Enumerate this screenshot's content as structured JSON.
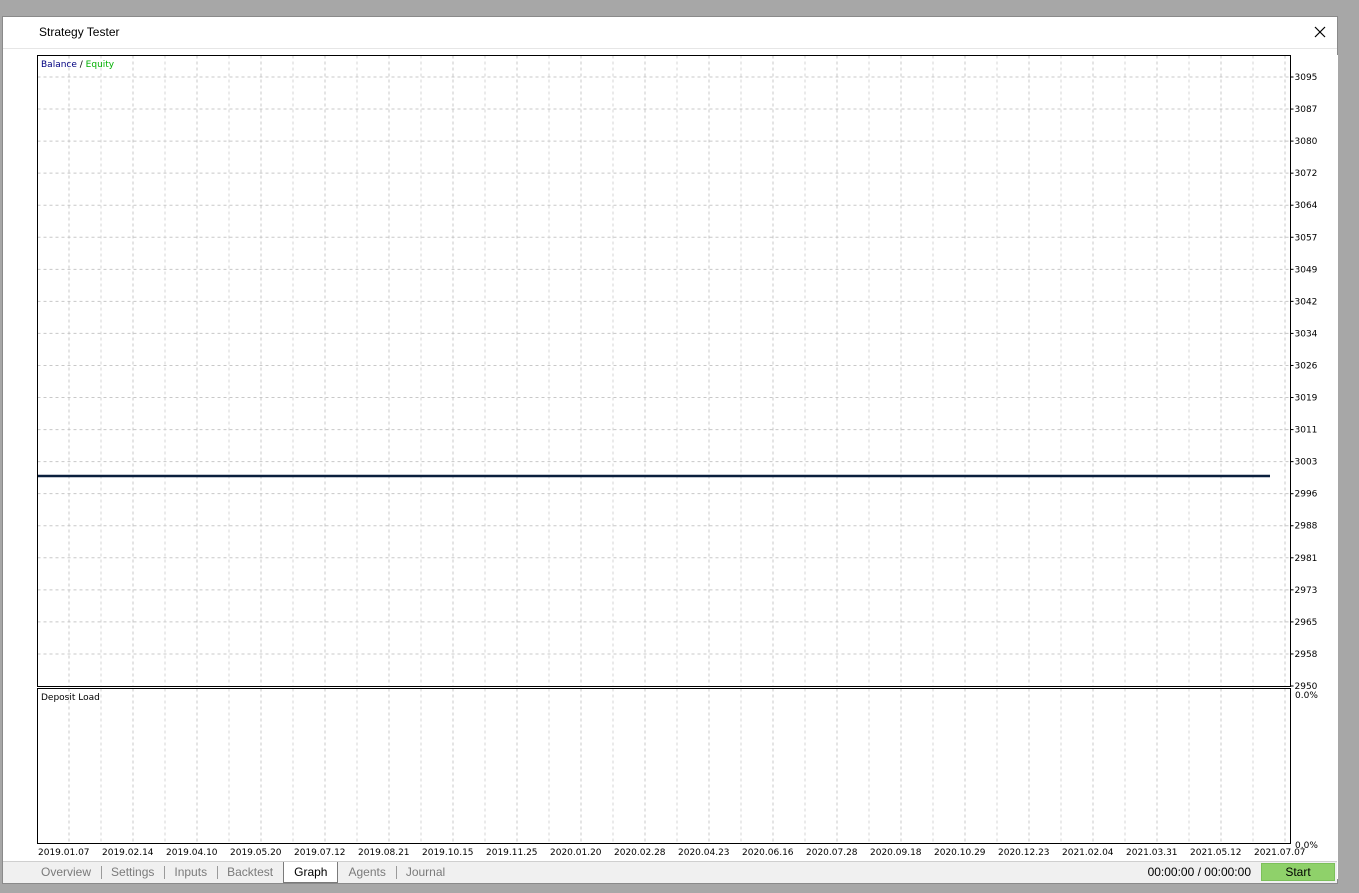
{
  "window": {
    "title": "Strategy Tester"
  },
  "legend": {
    "balance_label": "Balance",
    "separator": " / ",
    "equity_label": "Equity",
    "balance_color": "#000080",
    "equity_color": "#00b000"
  },
  "deposit_panel": {
    "label": "Deposit Load",
    "top_value": "0.0%",
    "bottom_value": "0.0%"
  },
  "chart_data": {
    "type": "line",
    "ylabel": "",
    "xlabel": "",
    "yticks": [
      "3095",
      "3087",
      "3080",
      "3072",
      "3064",
      "3057",
      "3049",
      "3042",
      "3034",
      "3026",
      "3019",
      "3011",
      "3003",
      "2996",
      "2988",
      "2981",
      "2973",
      "2965",
      "2958",
      "2950"
    ],
    "ylim": [
      2950,
      3101
    ],
    "xticks": [
      "2019.01.07",
      "2019.02.14",
      "2019.04.10",
      "2019.05.20",
      "2019.07.12",
      "2019.08.21",
      "2019.10.15",
      "2019.11.25",
      "2020.01.20",
      "2020.02.28",
      "2020.04.23",
      "2020.06.16",
      "2020.07.28",
      "2020.09.18",
      "2020.10.29",
      "2020.12.23",
      "2021.02.04",
      "2021.03.31",
      "2021.05.12",
      "2021.07.07"
    ],
    "series": [
      {
        "name": "Balance",
        "color": "#000080",
        "x": [
          "2019.01.07",
          "2021.07.07"
        ],
        "values": [
          3000,
          3000
        ]
      },
      {
        "name": "Equity",
        "color": "#00b000",
        "x": [
          "2019.01.07",
          "2021.07.07"
        ],
        "values": [
          3000,
          3000
        ]
      }
    ],
    "grid": true
  },
  "tabs": [
    {
      "label": "Overview",
      "active": false
    },
    {
      "label": "Settings",
      "active": false
    },
    {
      "label": "Inputs",
      "active": false
    },
    {
      "label": "Backtest",
      "active": false
    },
    {
      "label": "Graph",
      "active": true
    },
    {
      "label": "Agents",
      "active": false
    },
    {
      "label": "Journal",
      "active": false
    }
  ],
  "status": {
    "timer": "00:00:00 / 00:00:00",
    "start_label": "Start"
  },
  "icons": {
    "close": "close-icon"
  }
}
